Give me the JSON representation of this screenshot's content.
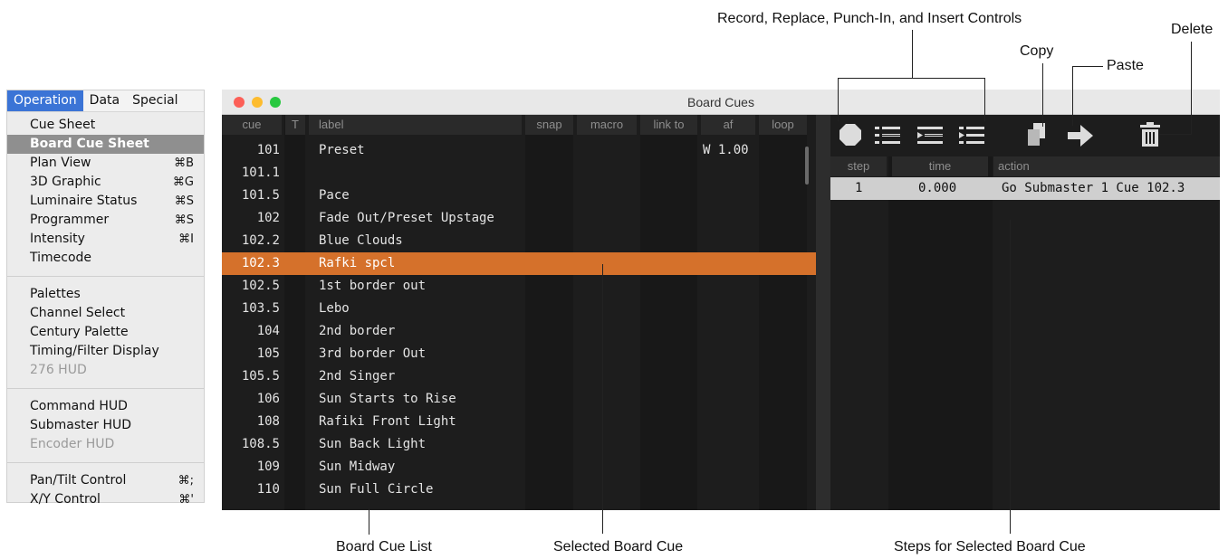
{
  "menu": {
    "bar": [
      "Operation",
      "Data",
      "Special"
    ],
    "group1": [
      {
        "label": "Cue Sheet",
        "shortcut": ""
      },
      {
        "label": "Board Cue Sheet",
        "shortcut": ""
      },
      {
        "label": "Plan View",
        "shortcut": "⌘B"
      },
      {
        "label": "3D Graphic",
        "shortcut": "⌘G"
      },
      {
        "label": "Luminaire Status",
        "shortcut": "⌘S"
      },
      {
        "label": "Programmer",
        "shortcut": "⌘S"
      },
      {
        "label": "Intensity",
        "shortcut": "⌘I"
      },
      {
        "label": "Timecode",
        "shortcut": ""
      }
    ],
    "group2": [
      {
        "label": "Palettes",
        "shortcut": ""
      },
      {
        "label": "Channel Select",
        "shortcut": ""
      },
      {
        "label": "Century Palette",
        "shortcut": ""
      },
      {
        "label": "Timing/Filter Display",
        "shortcut": ""
      },
      {
        "label": "276 HUD",
        "shortcut": ""
      }
    ],
    "group3": [
      {
        "label": "Command HUD",
        "shortcut": ""
      },
      {
        "label": "Submaster HUD",
        "shortcut": ""
      },
      {
        "label": "Encoder HUD",
        "shortcut": ""
      }
    ],
    "group4": [
      {
        "label": "Pan/Tilt Control",
        "shortcut": "⌘;"
      },
      {
        "label": "X/Y Control",
        "shortcut": "⌘'"
      }
    ]
  },
  "window": {
    "title": "Board Cues",
    "cue_columns": [
      "cue",
      "T",
      "label",
      "snap",
      "macro",
      "link to",
      "af",
      "loop"
    ],
    "cues": [
      {
        "cue": "101",
        "label": "Preset",
        "af": "W 1.00"
      },
      {
        "cue": "101.1",
        "label": "",
        "af": ""
      },
      {
        "cue": "101.5",
        "label": "Pace",
        "af": ""
      },
      {
        "cue": "102",
        "label": "Fade Out/Preset Upstage",
        "af": ""
      },
      {
        "cue": "102.2",
        "label": "Blue Clouds",
        "af": ""
      },
      {
        "cue": "102.3",
        "label": "Rafki spcl",
        "af": ""
      },
      {
        "cue": "102.5",
        "label": "1st border out",
        "af": ""
      },
      {
        "cue": "103.5",
        "label": "Lebo",
        "af": ""
      },
      {
        "cue": "104",
        "label": "2nd border",
        "af": ""
      },
      {
        "cue": "105",
        "label": "3rd border Out",
        "af": ""
      },
      {
        "cue": "105.5",
        "label": "2nd Singer",
        "af": ""
      },
      {
        "cue": "106",
        "label": "Sun Starts to Rise",
        "af": ""
      },
      {
        "cue": "108",
        "label": "Rafiki Front Light",
        "af": ""
      },
      {
        "cue": "108.5",
        "label": "Sun Back Light",
        "af": ""
      },
      {
        "cue": "109",
        "label": "Sun Midway",
        "af": ""
      },
      {
        "cue": "110",
        "label": "Sun Full Circle",
        "af": ""
      }
    ],
    "selected_cue": "102.3",
    "toolbar_icons": [
      "record-icon",
      "replace-icon",
      "punch-in-icon",
      "insert-icon",
      "copy-icon",
      "paste-icon",
      "delete-icon"
    ],
    "step_columns": [
      "step",
      "time",
      "action"
    ],
    "steps": [
      {
        "step": "1",
        "time": "0.000",
        "action": "Go Submaster 1 Cue 102.3"
      }
    ]
  },
  "annotations": {
    "record_controls": "Record, Replace, Punch-In, and Insert Controls",
    "copy": "Copy",
    "paste": "Paste",
    "delete": "Delete",
    "cue_list": "Board Cue List",
    "selected_cue": "Selected Board Cue",
    "steps": "Steps for Selected Board Cue"
  },
  "colors": {
    "selected_row": "#d5712b",
    "menu_highlight": "#8f8f8f",
    "menubar_active": "#3b74d6"
  }
}
